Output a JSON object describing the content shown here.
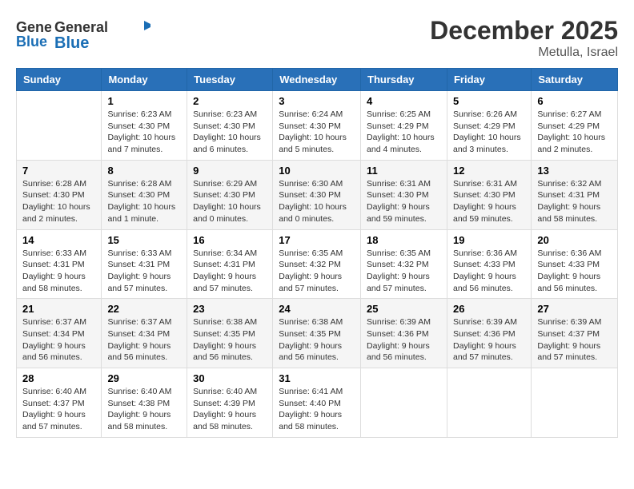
{
  "logo": {
    "general": "General",
    "blue": "Blue"
  },
  "title": "December 2025",
  "location": "Metulla, Israel",
  "days_header": [
    "Sunday",
    "Monday",
    "Tuesday",
    "Wednesday",
    "Thursday",
    "Friday",
    "Saturday"
  ],
  "weeks": [
    [
      {
        "day": "",
        "info": ""
      },
      {
        "day": "1",
        "info": "Sunrise: 6:23 AM\nSunset: 4:30 PM\nDaylight: 10 hours\nand 7 minutes."
      },
      {
        "day": "2",
        "info": "Sunrise: 6:23 AM\nSunset: 4:30 PM\nDaylight: 10 hours\nand 6 minutes."
      },
      {
        "day": "3",
        "info": "Sunrise: 6:24 AM\nSunset: 4:30 PM\nDaylight: 10 hours\nand 5 minutes."
      },
      {
        "day": "4",
        "info": "Sunrise: 6:25 AM\nSunset: 4:29 PM\nDaylight: 10 hours\nand 4 minutes."
      },
      {
        "day": "5",
        "info": "Sunrise: 6:26 AM\nSunset: 4:29 PM\nDaylight: 10 hours\nand 3 minutes."
      },
      {
        "day": "6",
        "info": "Sunrise: 6:27 AM\nSunset: 4:29 PM\nDaylight: 10 hours\nand 2 minutes."
      }
    ],
    [
      {
        "day": "7",
        "info": "Sunrise: 6:28 AM\nSunset: 4:30 PM\nDaylight: 10 hours\nand 2 minutes."
      },
      {
        "day": "8",
        "info": "Sunrise: 6:28 AM\nSunset: 4:30 PM\nDaylight: 10 hours\nand 1 minute."
      },
      {
        "day": "9",
        "info": "Sunrise: 6:29 AM\nSunset: 4:30 PM\nDaylight: 10 hours\nand 0 minutes."
      },
      {
        "day": "10",
        "info": "Sunrise: 6:30 AM\nSunset: 4:30 PM\nDaylight: 10 hours\nand 0 minutes."
      },
      {
        "day": "11",
        "info": "Sunrise: 6:31 AM\nSunset: 4:30 PM\nDaylight: 9 hours\nand 59 minutes."
      },
      {
        "day": "12",
        "info": "Sunrise: 6:31 AM\nSunset: 4:30 PM\nDaylight: 9 hours\nand 59 minutes."
      },
      {
        "day": "13",
        "info": "Sunrise: 6:32 AM\nSunset: 4:31 PM\nDaylight: 9 hours\nand 58 minutes."
      }
    ],
    [
      {
        "day": "14",
        "info": "Sunrise: 6:33 AM\nSunset: 4:31 PM\nDaylight: 9 hours\nand 58 minutes."
      },
      {
        "day": "15",
        "info": "Sunrise: 6:33 AM\nSunset: 4:31 PM\nDaylight: 9 hours\nand 57 minutes."
      },
      {
        "day": "16",
        "info": "Sunrise: 6:34 AM\nSunset: 4:31 PM\nDaylight: 9 hours\nand 57 minutes."
      },
      {
        "day": "17",
        "info": "Sunrise: 6:35 AM\nSunset: 4:32 PM\nDaylight: 9 hours\nand 57 minutes."
      },
      {
        "day": "18",
        "info": "Sunrise: 6:35 AM\nSunset: 4:32 PM\nDaylight: 9 hours\nand 57 minutes."
      },
      {
        "day": "19",
        "info": "Sunrise: 6:36 AM\nSunset: 4:33 PM\nDaylight: 9 hours\nand 56 minutes."
      },
      {
        "day": "20",
        "info": "Sunrise: 6:36 AM\nSunset: 4:33 PM\nDaylight: 9 hours\nand 56 minutes."
      }
    ],
    [
      {
        "day": "21",
        "info": "Sunrise: 6:37 AM\nSunset: 4:34 PM\nDaylight: 9 hours\nand 56 minutes."
      },
      {
        "day": "22",
        "info": "Sunrise: 6:37 AM\nSunset: 4:34 PM\nDaylight: 9 hours\nand 56 minutes."
      },
      {
        "day": "23",
        "info": "Sunrise: 6:38 AM\nSunset: 4:35 PM\nDaylight: 9 hours\nand 56 minutes."
      },
      {
        "day": "24",
        "info": "Sunrise: 6:38 AM\nSunset: 4:35 PM\nDaylight: 9 hours\nand 56 minutes."
      },
      {
        "day": "25",
        "info": "Sunrise: 6:39 AM\nSunset: 4:36 PM\nDaylight: 9 hours\nand 56 minutes."
      },
      {
        "day": "26",
        "info": "Sunrise: 6:39 AM\nSunset: 4:36 PM\nDaylight: 9 hours\nand 57 minutes."
      },
      {
        "day": "27",
        "info": "Sunrise: 6:39 AM\nSunset: 4:37 PM\nDaylight: 9 hours\nand 57 minutes."
      }
    ],
    [
      {
        "day": "28",
        "info": "Sunrise: 6:40 AM\nSunset: 4:37 PM\nDaylight: 9 hours\nand 57 minutes."
      },
      {
        "day": "29",
        "info": "Sunrise: 6:40 AM\nSunset: 4:38 PM\nDaylight: 9 hours\nand 58 minutes."
      },
      {
        "day": "30",
        "info": "Sunrise: 6:40 AM\nSunset: 4:39 PM\nDaylight: 9 hours\nand 58 minutes."
      },
      {
        "day": "31",
        "info": "Sunrise: 6:41 AM\nSunset: 4:40 PM\nDaylight: 9 hours\nand 58 minutes."
      },
      {
        "day": "",
        "info": ""
      },
      {
        "day": "",
        "info": ""
      },
      {
        "day": "",
        "info": ""
      }
    ]
  ]
}
